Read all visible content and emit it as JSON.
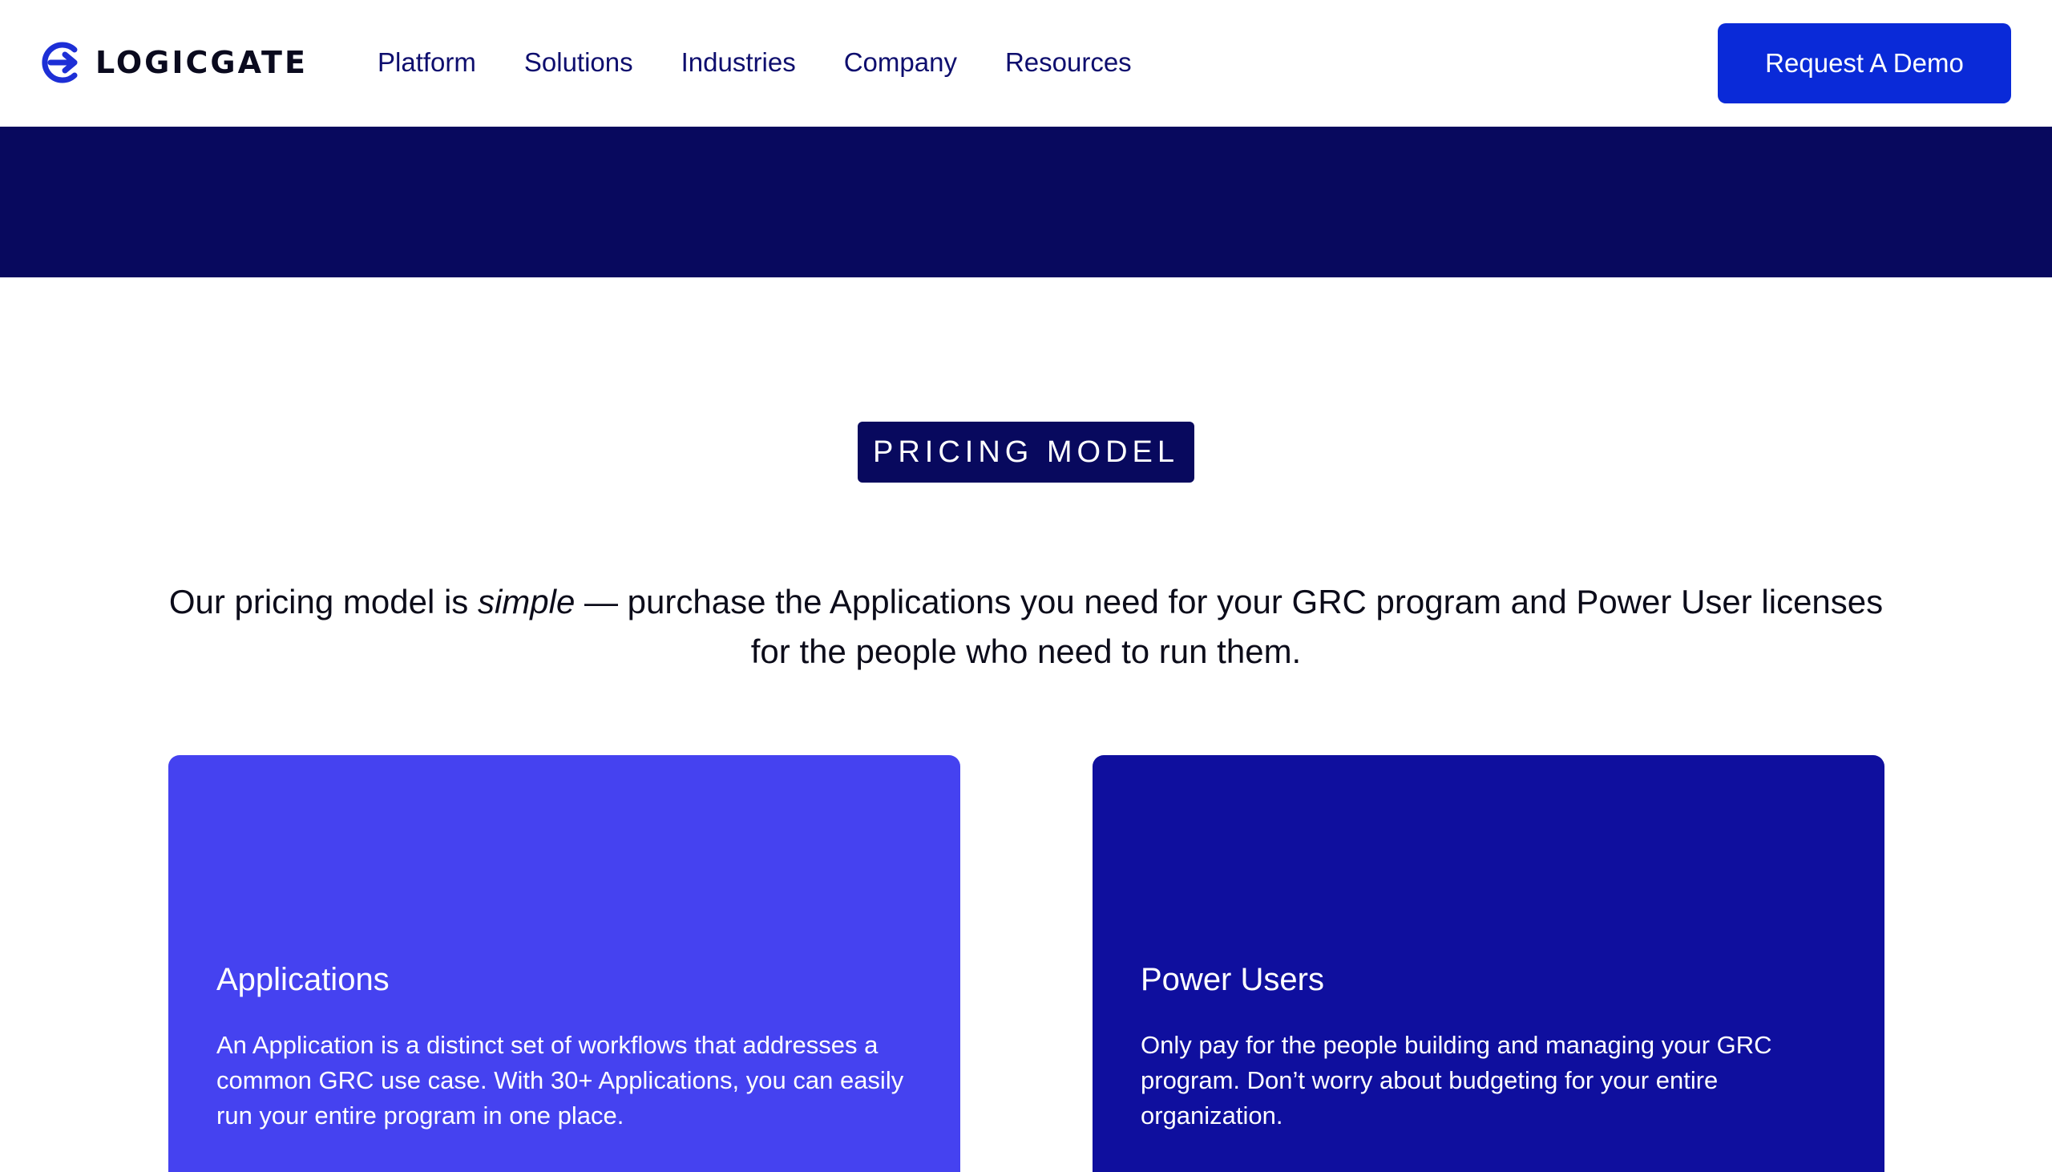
{
  "header": {
    "logo_text": "LOGICGATE",
    "nav": [
      "Platform",
      "Solutions",
      "Industries",
      "Company",
      "Resources"
    ],
    "cta_label": "Request A Demo"
  },
  "pricing": {
    "badge": "PRICING MODEL",
    "intro_before": "Our pricing model is ",
    "intro_emphasis": "simple",
    "intro_after": " — purchase the Applications you need for your GRC program and Power User licenses for the people who need to run them."
  },
  "cards": [
    {
      "title": "Applications",
      "body": "An Application is a distinct set of workflows that addresses a common GRC use case. With 30+ Applications, you can easily run your entire program in one place."
    },
    {
      "title": "Power Users",
      "body": "Only pay for the people building and managing your GRC program. Don’t worry about budgeting for your entire organization."
    }
  ],
  "colors": {
    "brand_blue": "#0a2ad8",
    "navy": "#08095e",
    "card_applications": "#4542f0",
    "card_power_users": "#0f0f9e"
  }
}
